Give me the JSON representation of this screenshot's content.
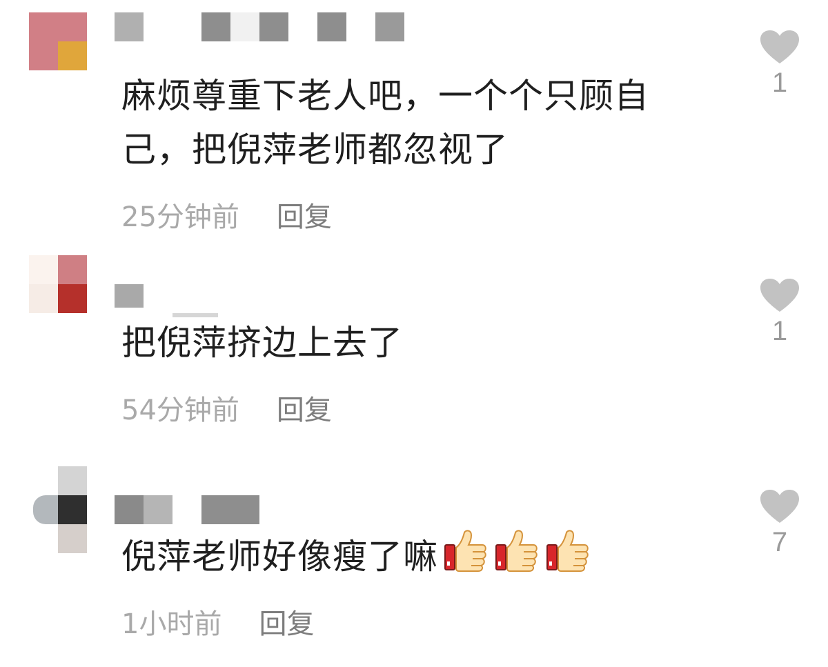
{
  "comments": [
    {
      "text_line1": "麻烦尊重下老人吧，一个个只顾自",
      "text_line2": "己，把倪萍老师都忽视了",
      "time": "25分钟前",
      "reply": "回复",
      "likes": "1"
    },
    {
      "text_line1": "把倪萍挤边上去了",
      "time": "54分钟前",
      "reply": "回复",
      "likes": "1"
    },
    {
      "text_line1": "倪萍老师好像瘦了嘛",
      "emoji": [
        "thumbs-up-icon",
        "thumbs-up-icon",
        "thumbs-up-icon"
      ],
      "time": "1小时前",
      "reply": "回复",
      "likes": "7"
    }
  ],
  "colors": {
    "heart": "#c2c2c2",
    "text": "#1f1f1f",
    "meta": "#a9a9a9",
    "reply": "#7d7d7d"
  },
  "icons": {
    "like": "heart-icon"
  }
}
